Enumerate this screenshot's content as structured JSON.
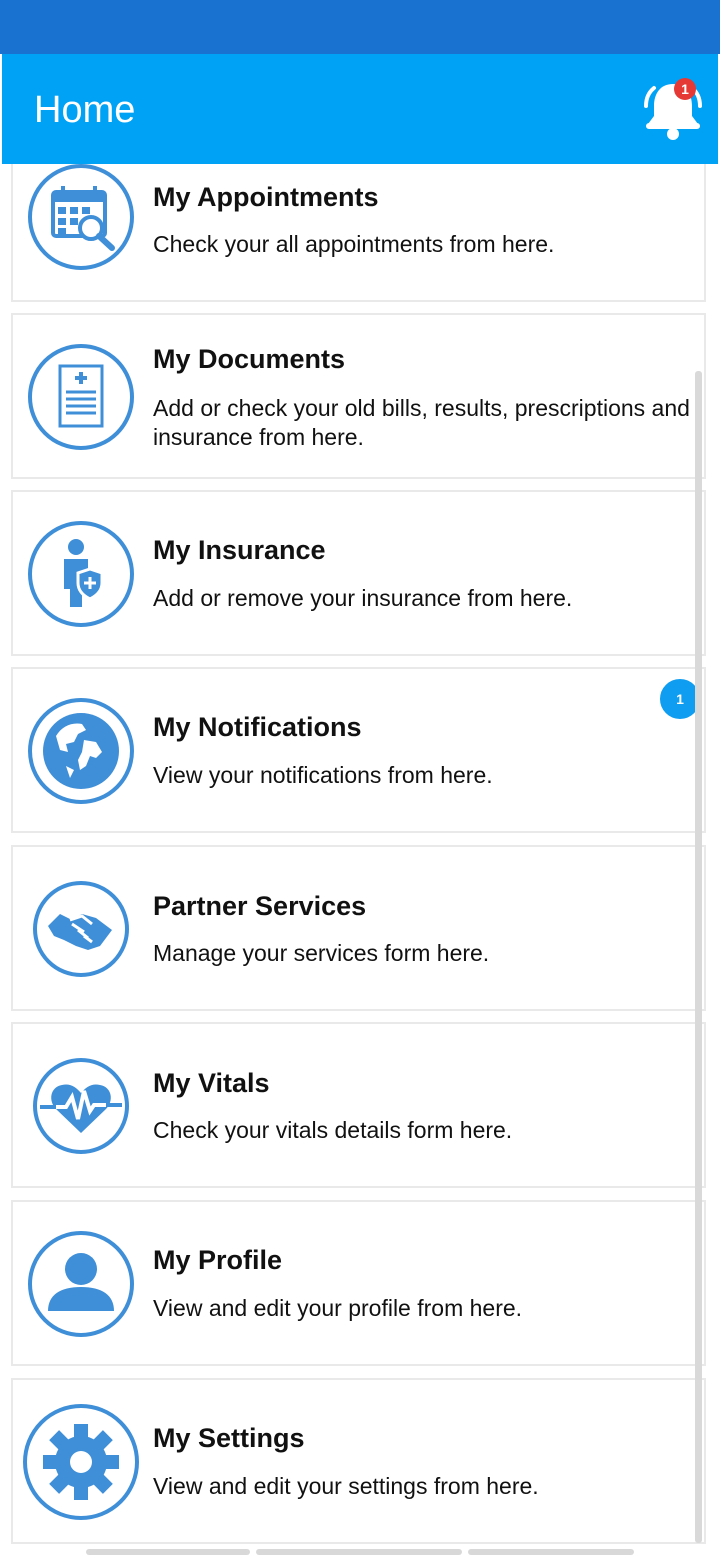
{
  "app_bar": {
    "title": "Home",
    "notification_count": "1"
  },
  "colors": {
    "status_bar": "#1a72d0",
    "app_bar": "#00a2f5",
    "accent": "#0e9df0",
    "icon_blue": "#3f8fd8",
    "badge_red": "#e53935"
  },
  "menu": {
    "items": [
      {
        "title": "My Appointments",
        "description": "Check your all appointments from here.",
        "icon": "calendar-search-icon"
      },
      {
        "title": "My Documents",
        "description": "Add or check your old bills, results, prescriptions and insurance from here.",
        "icon": "medical-document-icon"
      },
      {
        "title": "My Insurance",
        "description": "Add or remove your insurance from here.",
        "icon": "person-shield-icon"
      },
      {
        "title": "My Notifications",
        "description": "View  your notifications from here.",
        "icon": "globe-icon",
        "badge": "1"
      },
      {
        "title": "Partner Services",
        "description": "Manage your services form here.",
        "icon": "handshake-icon"
      },
      {
        "title": "My Vitals",
        "description": "Check your vitals details form here.",
        "icon": "heartbeat-icon"
      },
      {
        "title": "My Profile",
        "description": "View and edit your profile from here.",
        "icon": "user-profile-icon"
      },
      {
        "title": "My Settings",
        "description": "View and edit your settings from here.",
        "icon": "gear-icon"
      }
    ]
  }
}
